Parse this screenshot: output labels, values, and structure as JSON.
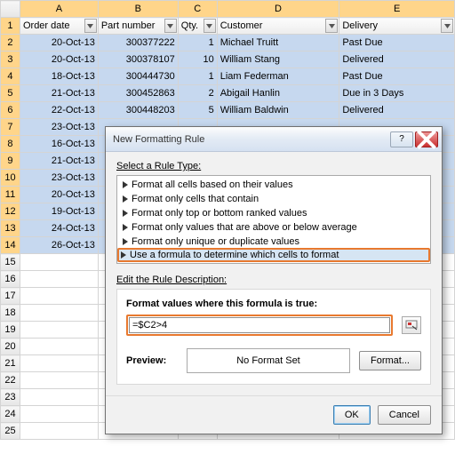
{
  "columns": {
    "A": "A",
    "B": "B",
    "C": "C",
    "D": "D",
    "E": "E"
  },
  "headers": {
    "A": "Order date",
    "B": "Part number",
    "C": "Qty.",
    "D": "Customer",
    "E": "Delivery"
  },
  "rows": [
    {
      "n": "1",
      "hdr": true
    },
    {
      "n": "2",
      "A": "20-Oct-13",
      "B": "300377222",
      "C": "1",
      "D": "Michael Truitt",
      "E": "Past Due",
      "sel": true
    },
    {
      "n": "3",
      "A": "20-Oct-13",
      "B": "300378107",
      "C": "10",
      "D": "William Stang",
      "E": "Delivered",
      "sel": true
    },
    {
      "n": "4",
      "A": "18-Oct-13",
      "B": "300444730",
      "C": "1",
      "D": "Liam Federman",
      "E": "Past Due",
      "sel": true
    },
    {
      "n": "5",
      "A": "21-Oct-13",
      "B": "300452863",
      "C": "2",
      "D": "Abigail Hanlin",
      "E": "Due in 3 Days",
      "sel": true
    },
    {
      "n": "6",
      "A": "22-Oct-13",
      "B": "300448203",
      "C": "5",
      "D": "William Baldwin",
      "E": "Delivered",
      "sel": true
    },
    {
      "n": "7",
      "A": "23-Oct-13",
      "sel": true
    },
    {
      "n": "8",
      "A": "16-Oct-13",
      "sel": true
    },
    {
      "n": "9",
      "A": "21-Oct-13",
      "sel": true
    },
    {
      "n": "10",
      "A": "23-Oct-13",
      "sel": true
    },
    {
      "n": "11",
      "A": "20-Oct-13",
      "sel": true
    },
    {
      "n": "12",
      "A": "19-Oct-13",
      "sel": true
    },
    {
      "n": "13",
      "A": "24-Oct-13",
      "sel": true
    },
    {
      "n": "14",
      "A": "26-Oct-13",
      "sel": true
    },
    {
      "n": "15"
    },
    {
      "n": "16"
    },
    {
      "n": "17"
    },
    {
      "n": "18"
    },
    {
      "n": "19"
    },
    {
      "n": "20"
    },
    {
      "n": "21"
    },
    {
      "n": "22"
    },
    {
      "n": "23"
    },
    {
      "n": "24"
    },
    {
      "n": "25"
    }
  ],
  "dialog": {
    "title": "New Formatting Rule",
    "select_label": "Select a Rule Type:",
    "rules": {
      "r0": "Format all cells based on their values",
      "r1": "Format only cells that contain",
      "r2": "Format only top or bottom ranked values",
      "r3": "Format only values that are above or below average",
      "r4": "Format only unique or duplicate values",
      "r5": "Use a formula to determine which cells to format"
    },
    "edit_label": "Edit the Rule Description:",
    "formula_label": "Format values where this formula is true:",
    "formula_value": "=$C2>4",
    "preview_label": "Preview:",
    "preview_text": "No Format Set",
    "format_btn": "Format...",
    "ok": "OK",
    "cancel": "Cancel",
    "help": "?"
  }
}
